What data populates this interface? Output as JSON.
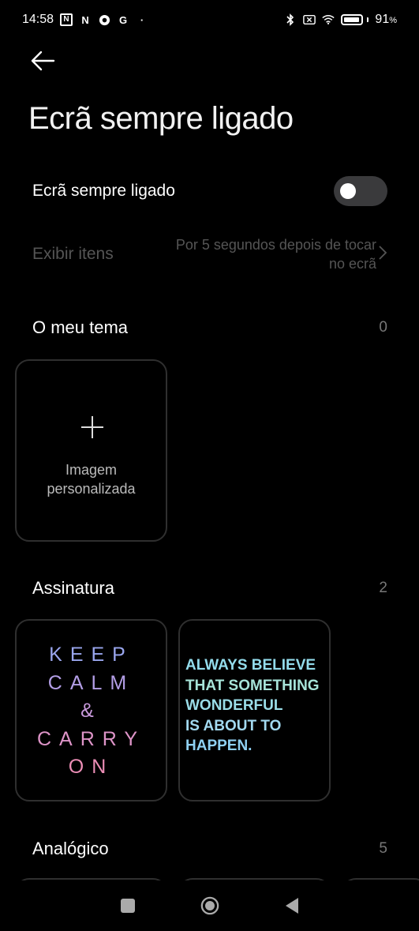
{
  "status": {
    "time": "14:58",
    "battery": "91",
    "battery_unit": "%",
    "battery_level": 0.91,
    "left_icons": [
      "nfc-n-icon",
      "nfc-icon",
      "chrome-icon",
      "google-icon",
      "dot-icon"
    ],
    "right_icons": [
      "bluetooth-icon",
      "no-sim-icon",
      "wifi-icon",
      "battery-icon"
    ]
  },
  "header": {
    "title": "Ecrã sempre ligado",
    "back_icon": "back-arrow-icon"
  },
  "aod": {
    "label": "Ecrã sempre ligado",
    "enabled": false
  },
  "display_items": {
    "label": "Exibir itens",
    "value_line1": "Por 5 segundos depois de tocar",
    "value_line2": "no ecrã"
  },
  "sections": {
    "my_theme": {
      "title": "O meu tema",
      "count": "0"
    },
    "signature": {
      "title": "Assinatura",
      "count": "2"
    },
    "analog": {
      "title": "Analógico",
      "count": "5"
    }
  },
  "custom_image": {
    "line1": "Imagem",
    "line2": "personalizada"
  },
  "signatures": {
    "keep_calm": {
      "lines": [
        "KEEP",
        "CALM",
        "&",
        "CARRY",
        "ON"
      ]
    },
    "always_believe": {
      "lines": [
        "ALWAYS BELIEVE",
        "THAT SOMETHING",
        "WONDERFUL",
        "IS ABOUT TO",
        "HAPPEN."
      ]
    }
  },
  "colors": {
    "background": "#000000",
    "muted_text": "#555555",
    "card_border": "#2f2f2f",
    "keep_gradient": [
      "#8fa6f2",
      "#f08ab0"
    ],
    "always_gradient": [
      "#8fdcf0",
      "#c8f0a8"
    ]
  },
  "nav": {
    "icons": [
      "recents-square-icon",
      "home-circle-icon",
      "back-triangle-icon"
    ]
  }
}
